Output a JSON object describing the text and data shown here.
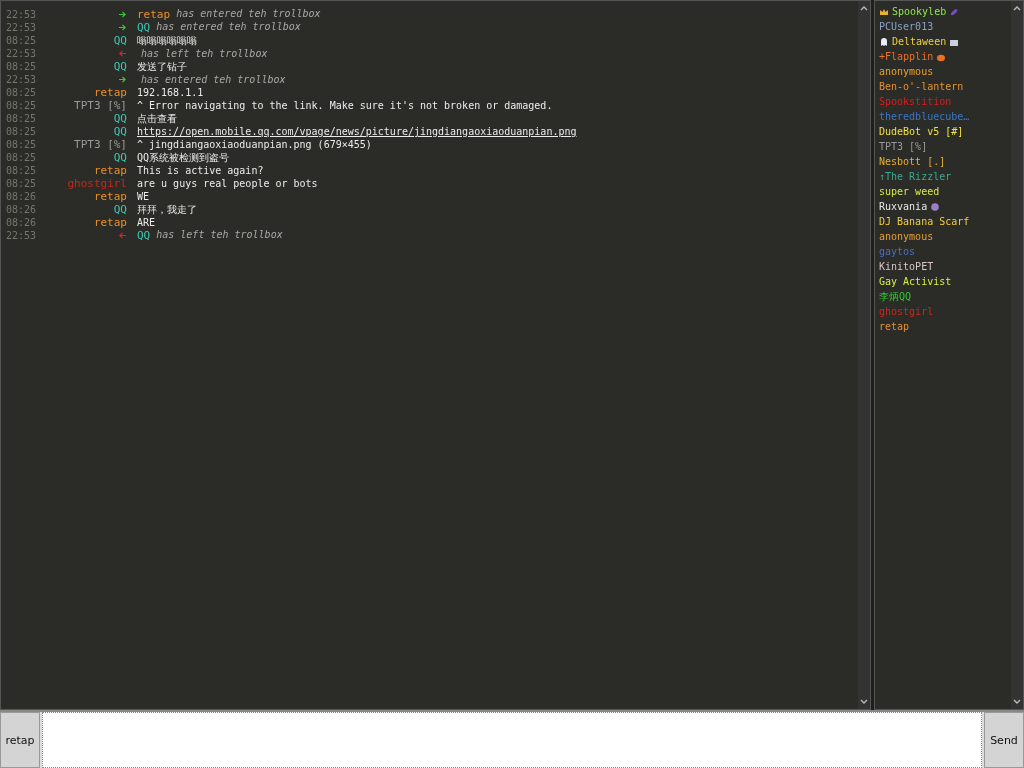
{
  "messages": [
    {
      "time": "22:53",
      "kind": "join",
      "name": "retap",
      "color": "#e8902c",
      "text": "has entered teh trollbox"
    },
    {
      "time": "22:53",
      "kind": "join",
      "name": "QQ",
      "color": "#3cc8b4",
      "text": "has entered teh trollbox"
    },
    {
      "time": "08:25",
      "kind": "message",
      "name": "QQ",
      "color": "#3cc8b4",
      "text": "嗡嗡嗡嗡嗡嗡"
    },
    {
      "time": "22:53",
      "kind": "leave",
      "text": "has left teh trollbox"
    },
    {
      "time": "08:25",
      "kind": "message",
      "name": "QQ",
      "color": "#3cc8b4",
      "text": "发送了钻子"
    },
    {
      "time": "22:53",
      "kind": "join",
      "text": "has entered teh trollbox"
    },
    {
      "time": "08:25",
      "kind": "message",
      "name": "retap",
      "color": "#e8902c",
      "text": "192.168.1.1"
    },
    {
      "time": "08:25",
      "kind": "message",
      "name": "TPT3 [%]",
      "color": "#9a9a9a",
      "text": "^ Error navigating to the link. Make sure it's not broken or damaged."
    },
    {
      "time": "08:25",
      "kind": "message",
      "name": "QQ",
      "color": "#3cc8b4",
      "text": "点击查看"
    },
    {
      "time": "08:25",
      "kind": "link",
      "name": "QQ",
      "color": "#3cc8b4",
      "text": "https://open.mobile.qq.com/vpage/news/picture/jingdiangaoxiaoduanpian.png"
    },
    {
      "time": "08:25",
      "kind": "message",
      "name": "TPT3 [%]",
      "color": "#9a9a9a",
      "text": "^ jingdiangaoxiaoduanpian.png (679×455)"
    },
    {
      "time": "08:25",
      "kind": "message",
      "name": "QQ",
      "color": "#3cc8b4",
      "text": "QQ系统被检测到盗号"
    },
    {
      "time": "08:25",
      "kind": "message",
      "name": "retap",
      "color": "#e8902c",
      "text": "This is active again?"
    },
    {
      "time": "08:25",
      "kind": "message",
      "name": "ghostgirl",
      "color": "#c8281c",
      "text": "are u guys real people or bots"
    },
    {
      "time": "08:26",
      "kind": "message",
      "name": "retap",
      "color": "#e8902c",
      "text": "WE"
    },
    {
      "time": "08:26",
      "kind": "message",
      "name": "QQ",
      "color": "#3cc8b4",
      "text": "拜拜，我走了"
    },
    {
      "time": "08:26",
      "kind": "message",
      "name": "retap",
      "color": "#e8902c",
      "text": "ARE"
    },
    {
      "time": "22:53",
      "kind": "leave",
      "name": "QQ",
      "color": "#3cc8b4",
      "text": "has left teh trollbox"
    }
  ],
  "users": [
    {
      "name": "Spookyleb",
      "color": "#8ee84a",
      "kind": "crowned"
    },
    {
      "name": "PCUser013",
      "color": "#8aa0c8"
    },
    {
      "name": "Deltaween",
      "color": "#e8d040",
      "kind": "ghost"
    },
    {
      "name": "+Flapplin",
      "color": "#e8702c",
      "kind": "pumpkin"
    },
    {
      "name": "anonymous",
      "color": "#e8a030"
    },
    {
      "name": "Ben-o'-lantern",
      "color": "#e8902c"
    },
    {
      "name": "Spookstition",
      "color": "#d02020"
    },
    {
      "name": "theredbluecube…",
      "color": "#3a78c8"
    },
    {
      "name": "DudeBot v5 [#]",
      "color": "#f0e040"
    },
    {
      "name": "TPT3 [%]",
      "color": "#9a9a9a"
    },
    {
      "name": "Nesbott [.]",
      "color": "#e8b030"
    },
    {
      "name": "↑The Rizzler",
      "color": "#3ca890"
    },
    {
      "name": "super weed",
      "color": "#d8e84a"
    },
    {
      "name": "Ruxvania",
      "color": "#e8e8e8",
      "kind": "orb"
    },
    {
      "name": "DJ Banana Scarf",
      "color": "#f0d040"
    },
    {
      "name": "anonymous",
      "color": "#e8a030"
    },
    {
      "name": "gaytos",
      "color": "#4a70c0"
    },
    {
      "name": "KinitoPET",
      "color": "#d8c8c8"
    },
    {
      "name": "Gay Activist",
      "color": "#d8f040"
    },
    {
      "name": "李炳QQ",
      "color": "#30c830"
    },
    {
      "name": "ghostgirl",
      "color": "#c8281c"
    },
    {
      "name": "retap",
      "color": "#e8902c"
    }
  ],
  "composer": {
    "user": "retap",
    "send": "Send"
  }
}
